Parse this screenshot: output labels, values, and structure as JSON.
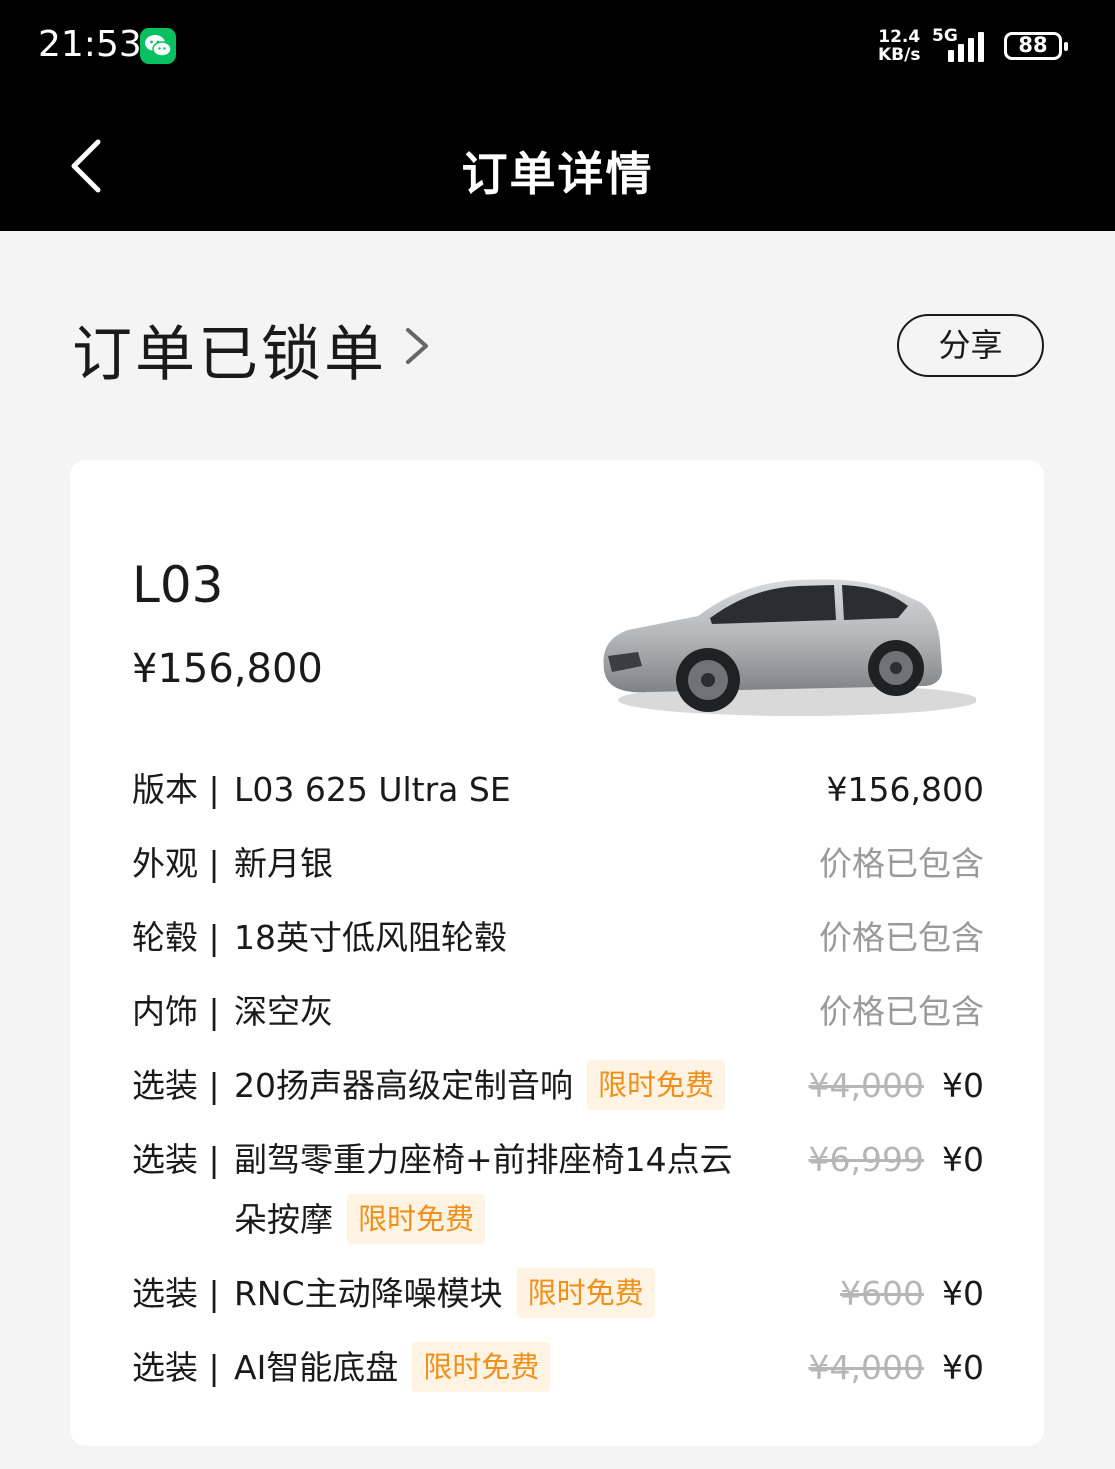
{
  "status_bar": {
    "time": "21:53",
    "speed_value": "12.4",
    "speed_unit": "KB/s",
    "network": "5G",
    "battery": "88",
    "notification_icon": "wechat-icon"
  },
  "nav": {
    "title": "订单详情",
    "back_icon": "chevron-left-icon"
  },
  "order": {
    "status": "订单已锁单",
    "share_label": "分享"
  },
  "vehicle": {
    "model": "L03",
    "price": "¥156,800",
    "image_icon": "car-image"
  },
  "rows": [
    {
      "label": "版本 |",
      "value": "L03 625 Ultra SE",
      "amount": "¥156,800"
    },
    {
      "label": "外观 |",
      "value": "新月银",
      "amount": "价格已包含"
    },
    {
      "label": "轮毂 |",
      "value": "18英寸低风阻轮毂",
      "amount": "价格已包含"
    },
    {
      "label": "内饰 |",
      "value": "深空灰",
      "amount": "价格已包含"
    },
    {
      "label": "选装 |",
      "value": "20扬声器高级定制音响",
      "badge": "限时免费",
      "original": "¥4,000",
      "amount": "¥0"
    },
    {
      "label": "选装 |",
      "value_line1": "副驾零重力座椅+前排座椅14点云",
      "value_line2": "朵按摩",
      "badge": "限时免费",
      "original": "¥6,999",
      "amount": "¥0"
    },
    {
      "label": "选装 |",
      "value": "RNC主动降噪模块",
      "badge": "限时免费",
      "original": "¥600",
      "amount": "¥0"
    },
    {
      "label": "选装 |",
      "value": "AI智能底盘",
      "badge": "限时免费",
      "original": "¥4,000",
      "amount": "¥0"
    }
  ],
  "colors": {
    "accent": "#f0901a",
    "badge_bg": "#fff3e3",
    "header_bg": "#000000",
    "page_bg": "#f4f4f4"
  }
}
